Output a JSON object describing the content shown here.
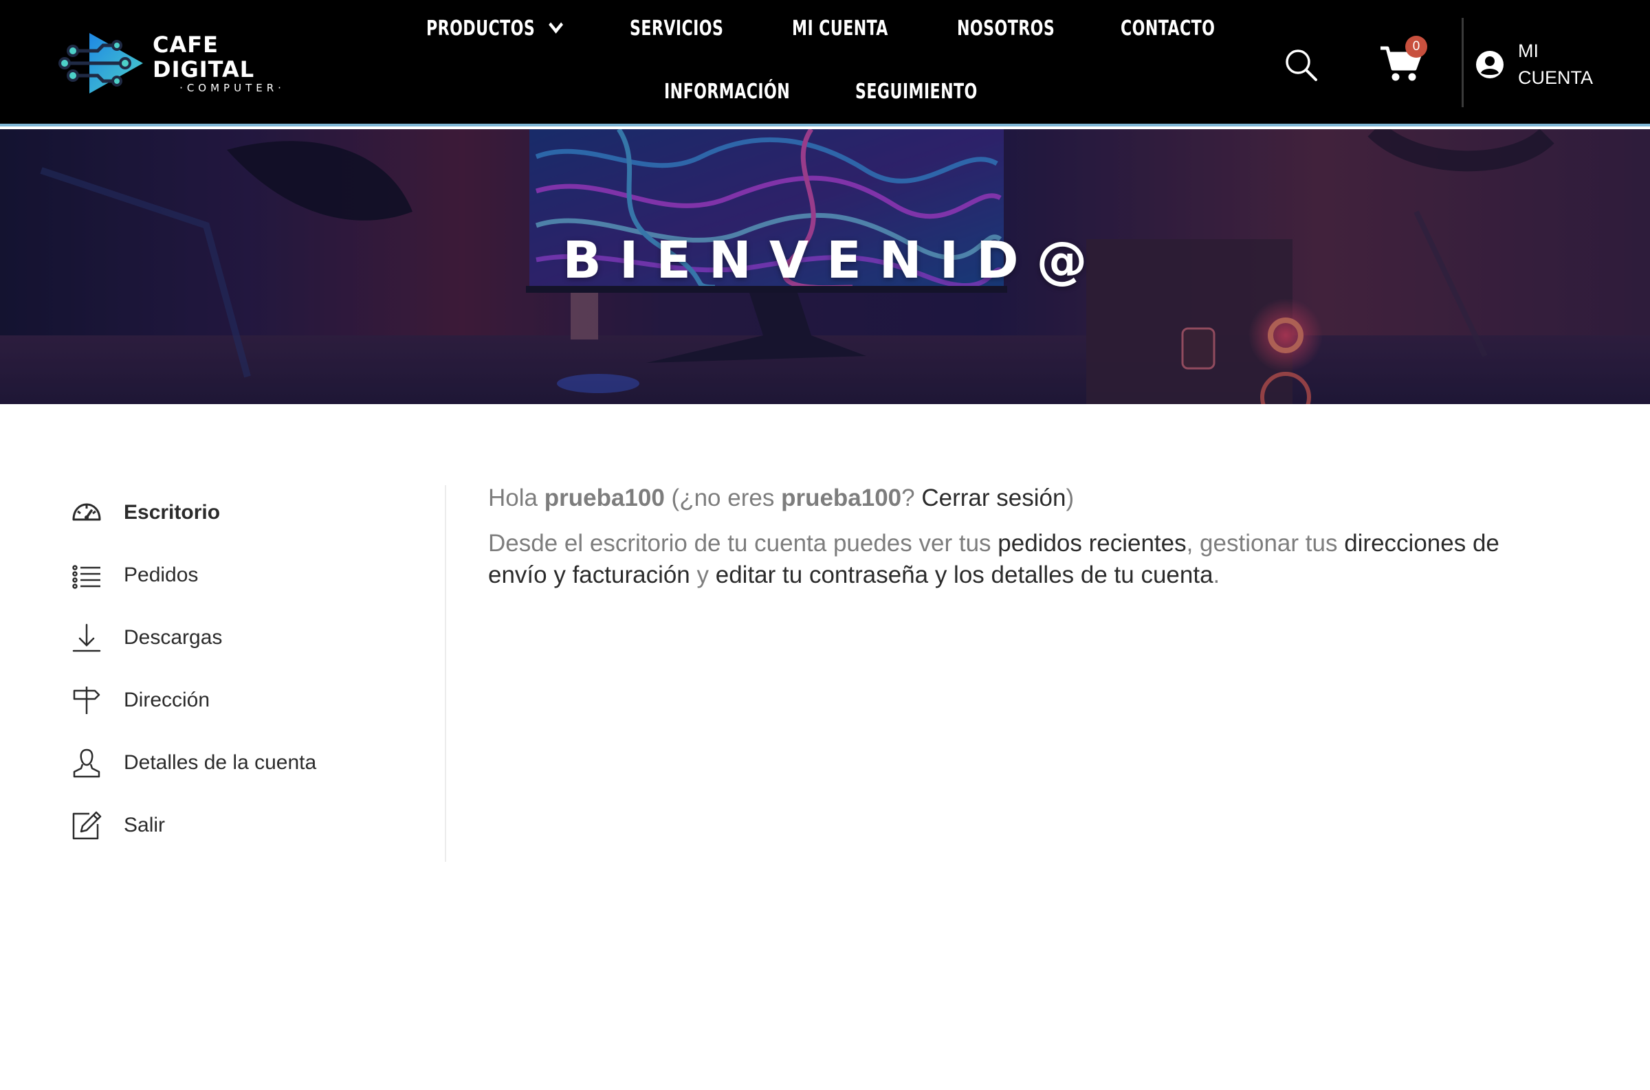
{
  "brand": {
    "name": "CAFE DIGITAL",
    "tagline": "·COMPUTER·",
    "colors": {
      "logo_gradient_start": "#1e88e5",
      "logo_gradient_end": "#4dd0c8",
      "header_bg": "#000000",
      "header_border": "#7fb7d6"
    }
  },
  "nav": {
    "productos": "PRODUCTOS",
    "servicios": "SERVICIOS",
    "mi_cuenta": "MI CUENTA",
    "nosotros": "NOSOTROS",
    "contacto": "CONTACTO",
    "informacion": "INFORMACIÓN",
    "seguimiento": "SEGUIMIENTO"
  },
  "header_actions": {
    "search_icon": "search-icon",
    "cart_icon": "cart-icon",
    "cart_count": "0",
    "cart_badge_color": "#c8503e",
    "account_line1": "MI",
    "account_line2": "CUENTA"
  },
  "hero": {
    "title": "BIENVENID@"
  },
  "sidebar": {
    "items": [
      {
        "label": "Escritorio",
        "icon": "dashboard-gauge-icon",
        "active": true
      },
      {
        "label": "Pedidos",
        "icon": "list-icon",
        "active": false
      },
      {
        "label": "Descargas",
        "icon": "download-icon",
        "active": false
      },
      {
        "label": "Dirección",
        "icon": "signpost-icon",
        "active": false
      },
      {
        "label": "Detalles de la cuenta",
        "icon": "user-icon",
        "active": false
      },
      {
        "label": "Salir",
        "icon": "edit-icon",
        "active": false
      }
    ]
  },
  "content": {
    "greeting_hola": "Hola",
    "username": "prueba100",
    "greeting_not_you": "(¿no eres",
    "greeting_question": "?",
    "logout_link": "Cerrar sesión",
    "greeting_close": ")",
    "desc_intro": "Desde el escritorio de tu cuenta puedes ver tus",
    "link_orders": "pedidos recientes",
    "desc_mid": ", gestionar tus",
    "link_addresses": "direcciones de envío y facturación",
    "desc_and": "y",
    "link_account": "editar tu contraseña y los detalles de tu cuenta",
    "desc_end": "."
  }
}
